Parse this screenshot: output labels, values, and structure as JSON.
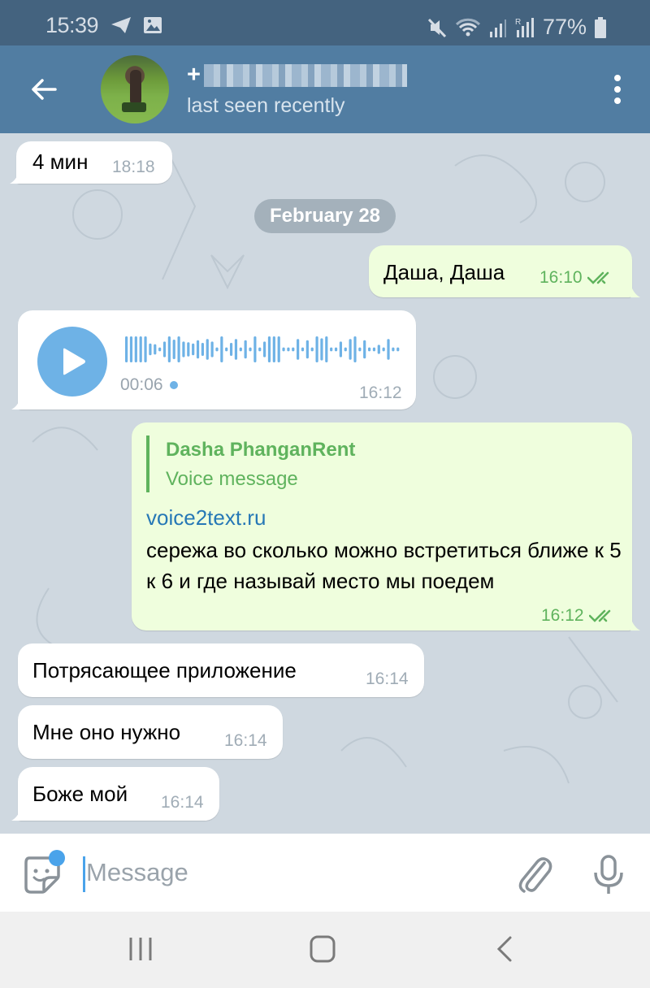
{
  "status_bar": {
    "time": "15:39",
    "left_icons": [
      "telegram-icon",
      "gallery-icon"
    ],
    "right_icons": [
      "mute-icon",
      "wifi-icon",
      "signal-icon",
      "roaming-signal-icon"
    ],
    "battery_percent": "77%"
  },
  "header": {
    "contact_name_prefix": "+",
    "contact_name_obscured": true,
    "status": "last seen recently"
  },
  "chat": {
    "messages": [
      {
        "direction": "in",
        "type": "text",
        "text": "4 мин",
        "time": "18:18"
      },
      {
        "type": "date",
        "text": "February 28"
      },
      {
        "direction": "out",
        "type": "text",
        "text": "Даша, Даша",
        "time": "16:10",
        "read": true
      },
      {
        "direction": "in",
        "type": "voice",
        "duration": "00:06",
        "time": "16:12",
        "unplayed": true
      },
      {
        "direction": "out",
        "type": "reply",
        "reply_to": {
          "name": "Dasha PhanganRent",
          "text": "Voice message"
        },
        "link": "voice2text.ru",
        "text": "сережа во сколько можно встретиться ближе к 5 к 6 и где называй место мы поедем",
        "time": "16:12",
        "read": true
      },
      {
        "direction": "in",
        "type": "text",
        "text": "Потрясающее приложение",
        "time": "16:14"
      },
      {
        "direction": "in",
        "type": "text",
        "text": "Мне оно нужно",
        "time": "16:14"
      },
      {
        "direction": "in",
        "type": "text",
        "text": "Боже мой",
        "time": "16:14"
      }
    ],
    "waveform_levels": [
      1,
      1,
      1,
      1,
      1,
      0.45,
      0.4,
      0.15,
      0.6,
      1,
      0.75,
      1,
      0.6,
      0.55,
      0.45,
      0.7,
      0.5,
      0.8,
      0.6,
      0.15,
      1,
      0.15,
      0.5,
      0.8,
      0.15,
      0.7,
      0.15,
      1,
      0.15,
      0.6,
      1,
      1,
      1,
      0.15,
      0.15,
      0.15,
      0.8,
      0.15,
      0.7,
      0.15,
      1,
      0.85,
      1,
      0.15,
      0.15,
      0.6,
      0.15,
      0.8,
      1,
      0.15,
      0.7,
      0.15,
      0.15,
      0.35,
      0.15,
      0.8,
      0.15,
      0.15
    ]
  },
  "composer": {
    "placeholder": "Message",
    "value": "",
    "has_sticker_badge": true
  },
  "colors": {
    "header_bg": "#517da2",
    "status_bar_bg": "#44637f",
    "outgoing_bubble": "#effedd",
    "incoming_bubble": "#ffffff",
    "accent_green": "#5fb35d",
    "link_blue": "#2678b6",
    "voice_blue": "#6eb2e6",
    "chat_bg": "#cfd8e0"
  }
}
